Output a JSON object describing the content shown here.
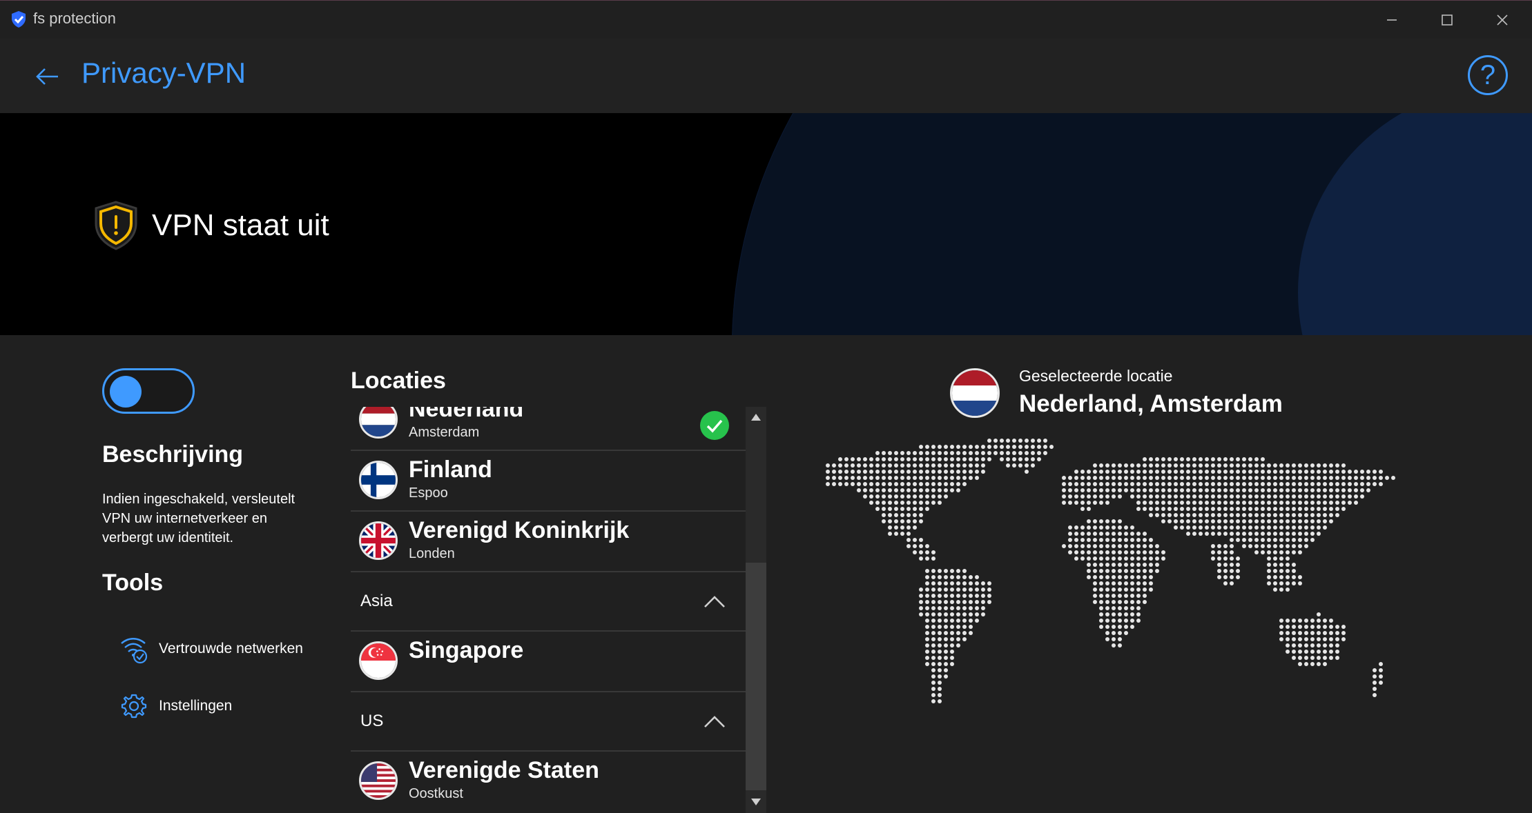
{
  "window": {
    "app_title": "fs protection",
    "controls": [
      "minimize-icon",
      "maximize-icon",
      "close-icon"
    ]
  },
  "header": {
    "title": "Privacy-VPN",
    "back_icon": "arrow-left-icon",
    "help_icon": "question-mark-icon",
    "help_glyph": "?"
  },
  "banner": {
    "status": "VPN staat uit",
    "status_icon": "warning-shield-icon"
  },
  "left": {
    "toggle_on": false,
    "description_heading": "Beschrijving",
    "description_text": "Indien ingeschakeld, versleutelt VPN uw internetverkeer en verbergt uw identiteit.",
    "tools_heading": "Tools",
    "tools": [
      {
        "label": "Vertrouwde netwerken",
        "icon": "trusted-wifi-icon"
      },
      {
        "label": "Instellingen",
        "icon": "gear-icon"
      }
    ]
  },
  "locations": {
    "heading": "Locaties",
    "rows": [
      {
        "kind": "country",
        "country": "Nederland",
        "city": "Amsterdam",
        "flag": "nl",
        "selected": true
      },
      {
        "kind": "country",
        "country": "Finland",
        "city": "Espoo",
        "flag": "fi",
        "selected": false
      },
      {
        "kind": "country",
        "country": "Verenigd Koninkrijk",
        "city": "Londen",
        "flag": "gb",
        "selected": false
      },
      {
        "kind": "group",
        "label": "Asia",
        "expanded": true
      },
      {
        "kind": "country",
        "country": "Singapore",
        "city": "",
        "flag": "sg",
        "selected": false
      },
      {
        "kind": "group",
        "label": "US",
        "expanded": true
      },
      {
        "kind": "country",
        "country": "Verenigde Staten",
        "city": "Oostkust",
        "flag": "us",
        "selected": false
      }
    ]
  },
  "selected": {
    "caption": "Geselecteerde locatie",
    "value": "Nederland, Amsterdam",
    "flag": "nl"
  },
  "colors": {
    "accent": "#3f9aff",
    "warning": "#f5b800",
    "success": "#27c24c",
    "background": "#202020",
    "banner": "#000000"
  }
}
